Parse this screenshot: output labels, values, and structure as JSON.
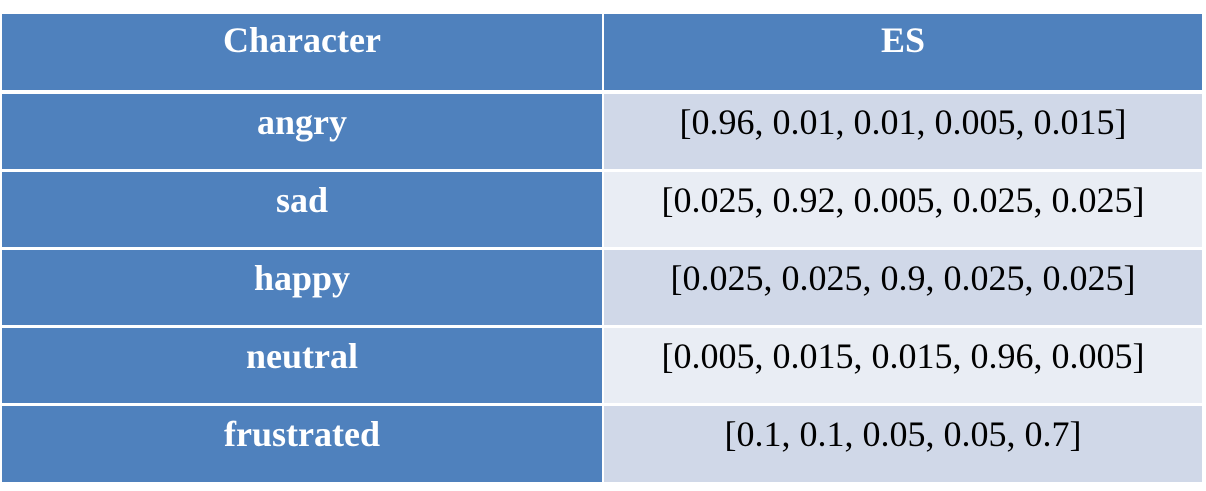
{
  "table": {
    "headers": [
      "Character",
      "ES"
    ],
    "rows": [
      {
        "character": "angry",
        "es": "[0.96, 0.01, 0.01, 0.005, 0.015]"
      },
      {
        "character": "sad",
        "es": "[0.025, 0.92, 0.005, 0.025, 0.025]"
      },
      {
        "character": "happy",
        "es": "[0.025, 0.025, 0.9, 0.025, 0.025]"
      },
      {
        "character": "neutral",
        "es": "[0.005, 0.015, 0.015, 0.96, 0.005]"
      },
      {
        "character": "frustrated",
        "es": "[0.1, 0.1, 0.05, 0.05, 0.7]"
      }
    ]
  },
  "colors": {
    "header_bg": "#4f81bd",
    "header_text": "#ffffff",
    "cell_odd_bg": "#d0d8e8",
    "cell_even_bg": "#e9edf4",
    "cell_text": "#000000"
  }
}
